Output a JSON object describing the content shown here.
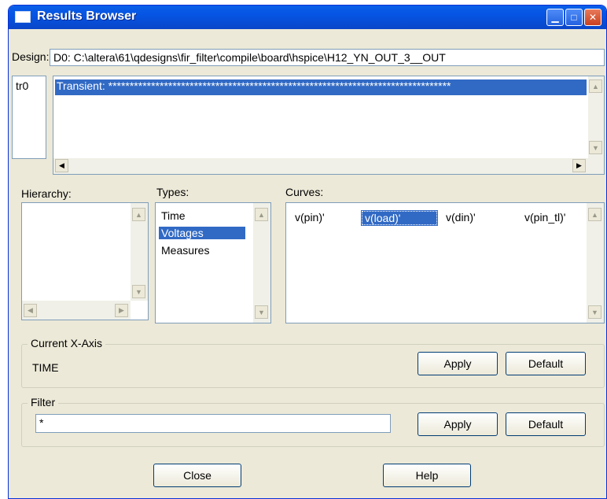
{
  "window": {
    "title": "Results Browser"
  },
  "design": {
    "label": "Design:",
    "value": "D0: C:\\altera\\61\\qdesigns\\fir_filter\\compile\\board\\hspice\\H12_YN_OUT_3__OUT"
  },
  "analyses": {
    "ids": [
      "tr0"
    ],
    "rows": [
      "Transient: ********************************************************************************"
    ]
  },
  "hierarchy": {
    "label": "Hierarchy:"
  },
  "types": {
    "label": "Types:",
    "items": [
      "Time",
      "Voltages",
      "Measures"
    ],
    "selected": "Voltages"
  },
  "curves": {
    "label": "Curves:",
    "items": [
      "v(pin)'",
      "v(load)'",
      "v(din)'",
      "v(pin_tl)'"
    ],
    "selected": "v(load)'"
  },
  "x_axis": {
    "title": "Current X-Axis",
    "value": "TIME",
    "apply_label": "Apply",
    "default_label": "Default"
  },
  "filter": {
    "title": "Filter",
    "value": "*",
    "apply_label": "Apply",
    "default_label": "Default"
  },
  "footer": {
    "close_label": "Close",
    "help_label": "Help"
  },
  "colors": {
    "title_bar": "#0554e3",
    "selection": "#316ac5",
    "window_bg": "#ece9d8"
  }
}
